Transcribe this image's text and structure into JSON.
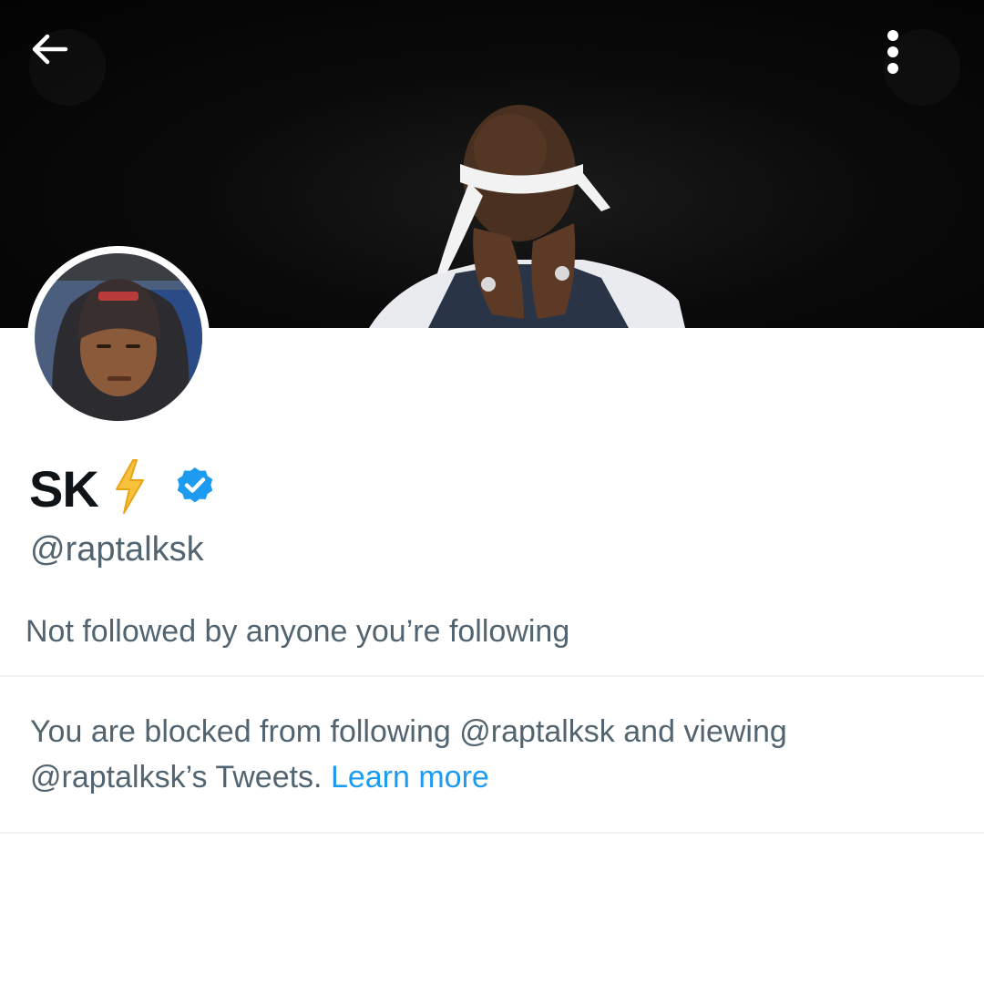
{
  "header": {
    "back_icon": "arrow-left-icon",
    "more_icon": "more-vertical-icon"
  },
  "profile": {
    "display_name": "SK",
    "name_emoji": "lightning-bolt",
    "verified_icon": "verified-badge-icon",
    "handle": "@raptalksk",
    "followed_by_text": "Not followed by anyone you’re following"
  },
  "blocked_notice": {
    "line_1": "You are blocked from following @raptalksk and viewing",
    "line_2": "@raptalksk’s Tweets.",
    "learn_more_label": "Learn more"
  },
  "colors": {
    "text_primary": "#0f1419",
    "text_secondary": "#536471",
    "link": "#1d9bf0",
    "verified": "#1d9bf0",
    "divider": "#eff3f4"
  }
}
